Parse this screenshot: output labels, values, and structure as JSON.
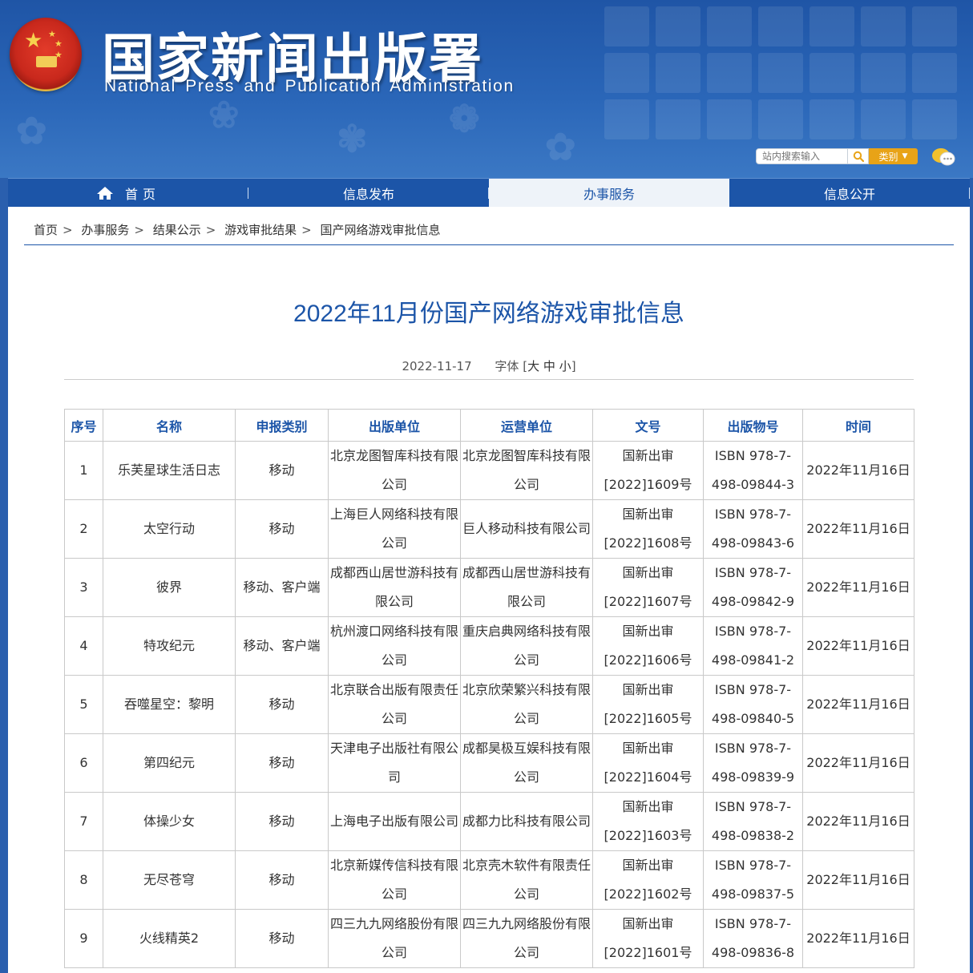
{
  "site": {
    "title": "国家新闻出版署",
    "subtitle": "National  Press and Publication Administration"
  },
  "search": {
    "placeholder": "站内搜索输入",
    "category_label": "类别"
  },
  "nav": {
    "items": [
      {
        "label": "首页"
      },
      {
        "label": "信息发布"
      },
      {
        "label": "办事服务"
      },
      {
        "label": "信息公开"
      }
    ]
  },
  "breadcrumb": [
    "首页",
    "办事服务",
    "结果公示",
    "游戏审批结果",
    "国产网络游戏审批信息"
  ],
  "article": {
    "title": "2022年11月份国产网络游戏审批信息",
    "date": "2022-11-17",
    "font_label": "字体",
    "font_open": "[",
    "font_large": "大",
    "font_medium": "中",
    "font_small": "小",
    "font_close": "]"
  },
  "table": {
    "headers": [
      "序号",
      "名称",
      "申报类别",
      "出版单位",
      "运营单位",
      "文号",
      "出版物号",
      "时间"
    ],
    "rows": [
      {
        "no": "1",
        "name": "乐芙星球生活日志",
        "type": "移动",
        "publisher": "北京龙图智库科技有限公司",
        "operator": "北京龙图智库科技有限公司",
        "doc": "国新出审[2022]1609号",
        "isbn": "ISBN 978-7-498-09844-3",
        "date": "2022年11月16日"
      },
      {
        "no": "2",
        "name": "太空行动",
        "type": "移动",
        "publisher": "上海巨人网络科技有限公司",
        "operator": "巨人移动科技有限公司",
        "doc": "国新出审[2022]1608号",
        "isbn": "ISBN 978-7-498-09843-6",
        "date": "2022年11月16日"
      },
      {
        "no": "3",
        "name": "彼界",
        "type": "移动、客户端",
        "publisher": "成都西山居世游科技有限公司",
        "operator": "成都西山居世游科技有限公司",
        "doc": "国新出审[2022]1607号",
        "isbn": "ISBN 978-7-498-09842-9",
        "date": "2022年11月16日"
      },
      {
        "no": "4",
        "name": "特攻纪元",
        "type": "移动、客户端",
        "publisher": "杭州渡口网络科技有限公司",
        "operator": "重庆启典网络科技有限公司",
        "doc": "国新出审[2022]1606号",
        "isbn": "ISBN 978-7-498-09841-2",
        "date": "2022年11月16日"
      },
      {
        "no": "5",
        "name": "吞噬星空：黎明",
        "type": "移动",
        "publisher": "北京联合出版有限责任公司",
        "operator": "北京欣荣繁兴科技有限公司",
        "doc": "国新出审[2022]1605号",
        "isbn": "ISBN 978-7-498-09840-5",
        "date": "2022年11月16日"
      },
      {
        "no": "6",
        "name": "第四纪元",
        "type": "移动",
        "publisher": "天津电子出版社有限公司",
        "operator": "成都昊极互娱科技有限公司",
        "doc": "国新出审[2022]1604号",
        "isbn": "ISBN 978-7-498-09839-9",
        "date": "2022年11月16日"
      },
      {
        "no": "7",
        "name": "体操少女",
        "type": "移动",
        "publisher": "上海电子出版有限公司",
        "operator": "成都力比科技有限公司",
        "doc": "国新出审[2022]1603号",
        "isbn": "ISBN 978-7-498-09838-2",
        "date": "2022年11月16日"
      },
      {
        "no": "8",
        "name": "无尽苍穹",
        "type": "移动",
        "publisher": "北京新媒传信科技有限公司",
        "operator": "北京壳木软件有限责任公司",
        "doc": "国新出审[2022]1602号",
        "isbn": "ISBN 978-7-498-09837-5",
        "date": "2022年11月16日"
      },
      {
        "no": "9",
        "name": "火线精英2",
        "type": "移动",
        "publisher": "四三九九网络股份有限公司",
        "operator": "四三九九网络股份有限公司",
        "doc": "国新出审[2022]1601号",
        "isbn": "ISBN 978-7-498-09836-8",
        "date": "2022年11月16日"
      }
    ]
  },
  "colors": {
    "header_blue": "#1f55a6",
    "nav_blue": "#1c55a8",
    "title_blue": "#1c55a8",
    "category_orange": "#e8a317"
  },
  "icons": {
    "emblem": "national-emblem-icon",
    "search": "search-icon",
    "home": "home-icon",
    "chat": "chat-icon"
  }
}
